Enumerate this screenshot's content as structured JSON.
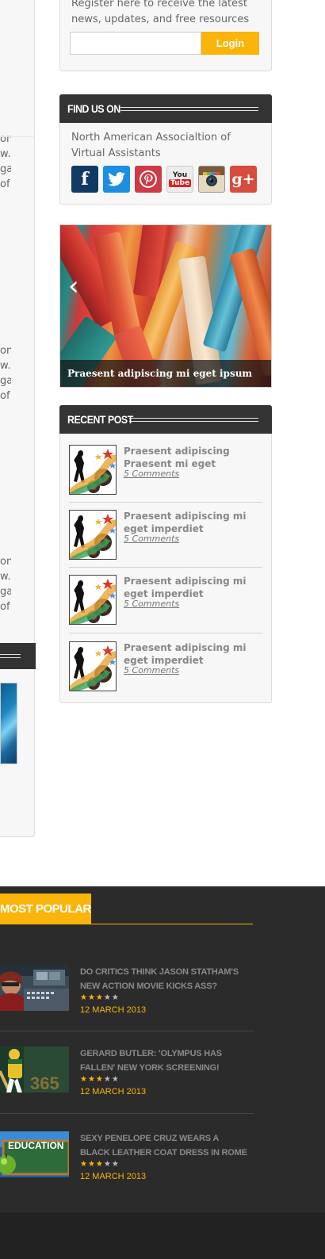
{
  "left_column": {
    "text_blocks": [
      [
        "on",
        "w.",
        "ga-",
        "of"
      ],
      [
        "on",
        "w.",
        "ga-",
        "of"
      ],
      [
        "on",
        "w.",
        "ga-",
        "of"
      ]
    ]
  },
  "register": {
    "text": "Register here to receive the latest news, updates, and free resources",
    "input_value": "",
    "button_label": "Login"
  },
  "find_us": {
    "title": "FIND US ON",
    "text": "North American Associaltion of Virtual Assistants",
    "icons": [
      {
        "name": "facebook",
        "glyph": "f",
        "color": "#0e3a64"
      },
      {
        "name": "twitter",
        "glyph": "t",
        "color": "#1c8fe0"
      },
      {
        "name": "pinterest",
        "glyph": "P",
        "color": "#cd3b46"
      },
      {
        "name": "youtube",
        "glyph": "You Tube",
        "color": "#e9e9e9"
      },
      {
        "name": "instagram",
        "glyph": "◉",
        "color": "#5b4a3a"
      },
      {
        "name": "google-plus",
        "glyph": "g+",
        "color": "#d84b3f"
      }
    ]
  },
  "slider": {
    "caption": "Praesent adipiscing mi eget ipsum imper",
    "arrow": "‹"
  },
  "recent_post": {
    "title": "RECENT POST",
    "items": [
      {
        "title": "Praesent adipiscing  Praesent mi eget",
        "comments": "5 Comments"
      },
      {
        "title": "Praesent adipiscing mi eget imperdiet",
        "comments": "5 Comments"
      },
      {
        "title": "Praesent adipiscing mi eget imperdiet",
        "comments": "5 Comments"
      },
      {
        "title": "Praesent adipiscing mi eget imperdiet",
        "comments": "5 Comments"
      }
    ]
  },
  "most_popular": {
    "title": "MOST POPULAR",
    "items": [
      {
        "title": "DO CRITICS THINK JASON STATHAM'S NEW ACTION MOVIE KICKS ASS?",
        "rating": 3,
        "max": 5,
        "date": "12 MARCH 2013"
      },
      {
        "title": "GERARD BUTLER: 'OLYMPUS HAS FALLEN' NEW YORK SCREENING!",
        "rating": 3,
        "max": 5,
        "date": "12 MARCH 2013"
      },
      {
        "title": "SEXY PENELOPE CRUZ WEARS A BLACK LEATHER COAT DRESS IN ROME",
        "rating": 3,
        "max": 5,
        "date": "12 MARCH 2013"
      }
    ],
    "thumb_label_3": "EDUCATION"
  },
  "colors": {
    "accent": "#fbb409",
    "dark_header": "#333333",
    "footer": "#2b2b2b"
  }
}
